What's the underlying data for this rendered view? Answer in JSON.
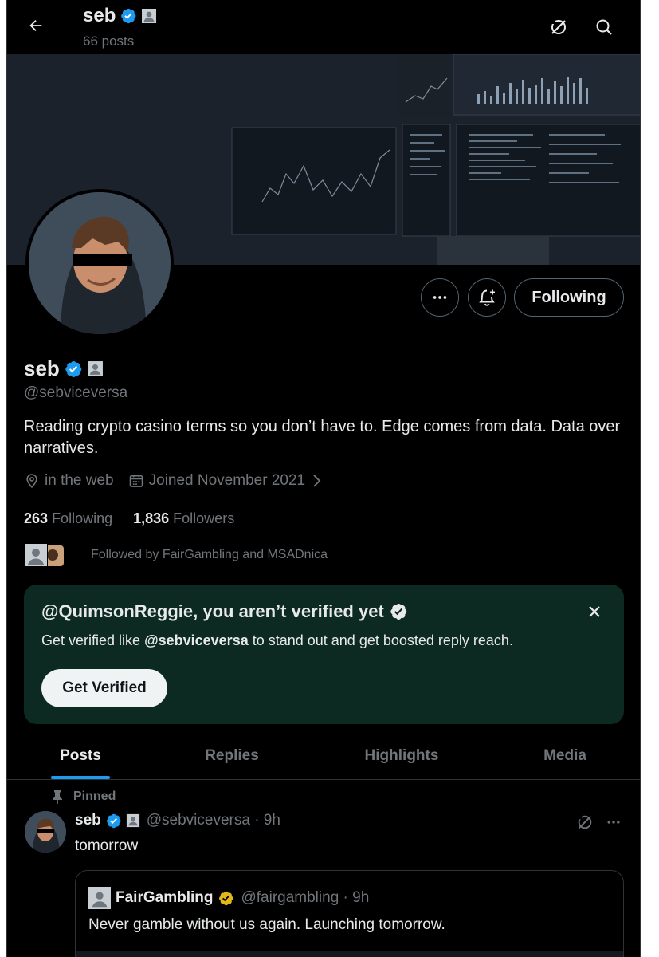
{
  "header": {
    "name": "seb",
    "posts_count": "66 posts"
  },
  "profile": {
    "name": "seb",
    "handle": "@sebviceversa",
    "bio": "Reading crypto casino terms so you don’t have to. Edge comes from data. Data over narratives.",
    "location": "in the web",
    "joined": "Joined November 2021",
    "following_count": "263",
    "following_label": "Following",
    "followers_count": "1,836",
    "followers_label": "Followers",
    "followed_by": "Followed by FairGambling and MSADnica",
    "follow_button_label": "Following"
  },
  "verify_card": {
    "title": "@QuimsonReggie, you aren’t verified yet",
    "text_prefix": "Get verified like ",
    "text_handle": "@sebviceversa",
    "text_suffix": " to stand out and get boosted reply reach.",
    "button_label": "Get Verified"
  },
  "tabs": [
    {
      "label": "Posts",
      "active": true
    },
    {
      "label": "Replies",
      "active": false
    },
    {
      "label": "Highlights",
      "active": false
    },
    {
      "label": "Media",
      "active": false
    }
  ],
  "pinned_post": {
    "pinned_label": "Pinned",
    "author_name": "seb",
    "author_handle_time": "@sebviceversa · 9h",
    "text": "tomorrow",
    "quote": {
      "author_name": "FairGambling",
      "author_handle_time": "@fairgambling · 9h",
      "text": "Never gamble without us again. Launching tomorrow."
    }
  },
  "colors": {
    "background": "#000000",
    "accent_blue": "#1d9bf0",
    "verified_blue": "#1d9bf0",
    "verified_gold": "#e2b719",
    "verify_card_bg": "#0c2a22",
    "muted_text": "#71767b",
    "primary_text": "#e7e9ea"
  },
  "icons": {
    "back": "arrow-left-icon",
    "grok": "grok-slash-icon",
    "search": "search-icon",
    "more": "more-dots-icon",
    "notify": "bell-plus-icon",
    "location": "location-pin-icon",
    "calendar": "calendar-icon",
    "pin": "pin-icon",
    "close": "close-icon"
  }
}
